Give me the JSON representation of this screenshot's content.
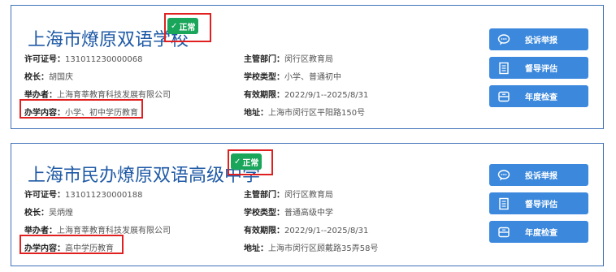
{
  "schools": [
    {
      "name": "上海市燎原双语学校",
      "status": "正常",
      "license_label": "许可证号：",
      "license": "131011230000068",
      "principal_label": "校长：",
      "principal": "胡国庆",
      "sponsor_label": "举办者：",
      "sponsor": "上海育莘教育科技发展有限公司",
      "content_label": "办学内容：",
      "content": "小学、初中学历教育",
      "dept_label": "主管部门：",
      "dept": "闵行区教育局",
      "type_label": "学校类型：",
      "type": "小学、普通初中",
      "validity_label": "有效期限：",
      "validity": "2022/9/1--2025/8/31",
      "address_label": "地址：",
      "address": "上海市闵行区平阳路150号",
      "buttons": [
        "投诉举报",
        "督导评估",
        "年度检查"
      ]
    },
    {
      "name": "上海市民办燎原双语高级中学",
      "status": "正常",
      "license_label": "许可证号：",
      "license": "131011230000188",
      "principal_label": "校长：",
      "principal": "吴炳煌",
      "sponsor_label": "举办者：",
      "sponsor": "上海育莘教育科技发展有限公司",
      "content_label": "办学内容：",
      "content": "高中学历教育",
      "dept_label": "主管部门：",
      "dept": "闵行区教育局",
      "type_label": "学校类型：",
      "type": "普通高级中学",
      "validity_label": "有效期限：",
      "validity": "2022/9/1--2025/8/31",
      "address_label": "地址：",
      "address": "上海市闵行区顾戴路35弄58号",
      "buttons": [
        "投诉举报",
        "督导评估",
        "年度检查"
      ]
    }
  ],
  "colors": {
    "title": "#1f5aa6",
    "card_border": "#3f72b8",
    "badge": "#19a55a",
    "highlight": "#e02020",
    "button": "#3b88dc"
  },
  "icons": [
    "chat-bubble-icon",
    "document-icon",
    "calendar-box-icon",
    "check-icon"
  ]
}
